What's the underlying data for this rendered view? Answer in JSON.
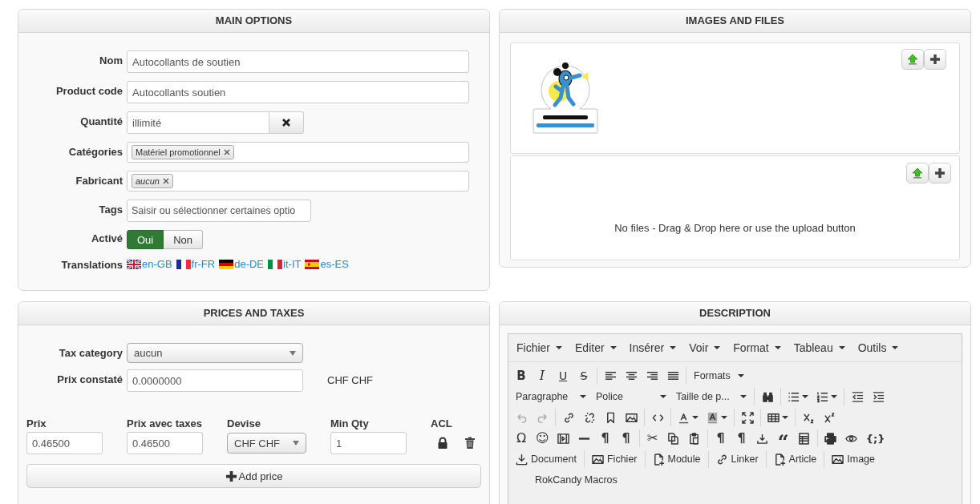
{
  "main_options": {
    "title": "MAIN OPTIONS",
    "fields": [
      {
        "kind": "text",
        "label": "Nom",
        "value": "Autocollants de soutien"
      },
      {
        "kind": "text",
        "label": "Product code",
        "value": "Autocollants soutien"
      },
      {
        "kind": "clearable",
        "label": "Quantité",
        "value": "illimité"
      },
      {
        "kind": "tags",
        "label": "Catégories",
        "tags": [
          {
            "text": "Matériel promotionnel",
            "italic": false
          }
        ]
      },
      {
        "kind": "tags",
        "label": "Fabricant",
        "tags": [
          {
            "text": "aucun",
            "italic": true
          }
        ]
      },
      {
        "kind": "short",
        "label": "Tags",
        "placeholder": "Saisir ou sélectionner certaines optio"
      },
      {
        "kind": "toggle",
        "label": "Activé",
        "options": [
          {
            "label": "Oui",
            "selected": true
          },
          {
            "label": "Non",
            "selected": false
          }
        ]
      },
      {
        "kind": "translations",
        "label": "Translations",
        "links": [
          {
            "kind": "gb",
            "text": "en-GB"
          },
          {
            "kind": "fr",
            "text": "fr-FR"
          },
          {
            "kind": "de",
            "text": "de-DE"
          },
          {
            "kind": "it",
            "text": "it-IT"
          },
          {
            "kind": "es",
            "text": "es-ES"
          }
        ]
      }
    ]
  },
  "images_and_files": {
    "title": "IMAGES AND FILES",
    "files_message": "No files - Drag & Drop here or use the upload button"
  },
  "prices_and_taxes": {
    "title": "PRICES AND TAXES",
    "tax_category": {
      "label": "Tax category",
      "value": "aucun"
    },
    "list_price": {
      "label": "Prix constaté",
      "value": "0.0000000",
      "currency": "CHF CHF"
    },
    "columns": [
      "Prix",
      "Prix avec taxes",
      "Devise",
      "Min Qty",
      "ACL"
    ],
    "rows": [
      {
        "price": "0.46500",
        "price_with_tax": "0.46500",
        "currency": "CHF CHF",
        "min_qty": "1"
      }
    ],
    "add_button": "Add price"
  },
  "description": {
    "title": "DESCRIPTION",
    "menubar": [
      "Fichier",
      "Editer",
      "Insérer",
      "Voir",
      "Format",
      "Tableau",
      "Outils"
    ],
    "toolbar_rows": [
      [
        {
          "kind": "bold",
          "text": "B",
          "disabled": false,
          "dropdown": false
        },
        {
          "kind": "italic",
          "text": "I",
          "disabled": false,
          "dropdown": false
        },
        {
          "kind": "underline",
          "text": "U",
          "disabled": false,
          "dropdown": false
        },
        {
          "kind": "strike",
          "text": "S",
          "disabled": false,
          "dropdown": false
        },
        {
          "kind": "sep"
        },
        {
          "kind": "alignleft",
          "disabled": false,
          "dropdown": false
        },
        {
          "kind": "aligncenter",
          "disabled": false,
          "dropdown": false
        },
        {
          "kind": "alignright",
          "disabled": false,
          "dropdown": false
        },
        {
          "kind": "justify",
          "disabled": false,
          "dropdown": false
        },
        {
          "kind": "sep"
        },
        {
          "kind": "select",
          "text": "Formats"
        }
      ],
      [
        {
          "kind": "select",
          "text": "Paragraphe"
        },
        {
          "kind": "select",
          "text": "Police"
        },
        {
          "kind": "select",
          "text": "Taille de p..."
        },
        {
          "kind": "sep"
        },
        {
          "kind": "search",
          "disabled": false,
          "dropdown": false
        },
        {
          "kind": "sep"
        },
        {
          "kind": "bullist",
          "disabled": false,
          "dropdown": true
        },
        {
          "kind": "numlist",
          "disabled": false,
          "dropdown": true
        },
        {
          "kind": "sep"
        },
        {
          "kind": "outdent",
          "disabled": false,
          "dropdown": false
        },
        {
          "kind": "indent",
          "disabled": false,
          "dropdown": false
        }
      ],
      [
        {
          "kind": "undo",
          "disabled": true,
          "dropdown": false
        },
        {
          "kind": "redo",
          "disabled": true,
          "dropdown": false
        },
        {
          "kind": "sep"
        },
        {
          "kind": "link",
          "disabled": false,
          "dropdown": false
        },
        {
          "kind": "unlink",
          "disabled": false,
          "dropdown": false
        },
        {
          "kind": "bookmark",
          "disabled": false,
          "dropdown": false
        },
        {
          "kind": "image",
          "disabled": false,
          "dropdown": false
        },
        {
          "kind": "sep"
        },
        {
          "kind": "code",
          "disabled": false,
          "dropdown": false
        },
        {
          "kind": "sep"
        },
        {
          "kind": "forecolor",
          "disabled": false,
          "dropdown": true
        },
        {
          "kind": "backcolor",
          "disabled": false,
          "dropdown": true
        },
        {
          "kind": "sep"
        },
        {
          "kind": "fullscreen",
          "disabled": false,
          "dropdown": false
        },
        {
          "kind": "sep"
        },
        {
          "kind": "table",
          "disabled": false,
          "dropdown": true
        },
        {
          "kind": "sep"
        },
        {
          "kind": "subscript",
          "disabled": false,
          "dropdown": false
        },
        {
          "kind": "superscript",
          "disabled": false,
          "dropdown": false
        }
      ],
      [
        {
          "kind": "omega",
          "text": "Ω",
          "disabled": false,
          "dropdown": false
        },
        {
          "kind": "emoticon",
          "text": "☺",
          "disabled": false,
          "dropdown": false
        },
        {
          "kind": "media",
          "disabled": false,
          "dropdown": false
        },
        {
          "kind": "hr",
          "disabled": false,
          "dropdown": false
        },
        {
          "kind": "ltr",
          "text": "¶",
          "disabled": false,
          "dropdown": false
        },
        {
          "kind": "rtl",
          "text": "¶",
          "disabled": false,
          "dropdown": false
        },
        {
          "kind": "sep"
        },
        {
          "kind": "cut",
          "text": "✂",
          "disabled": false,
          "dropdown": false
        },
        {
          "kind": "copy",
          "disabled": false,
          "dropdown": false
        },
        {
          "kind": "paste",
          "disabled": false,
          "dropdown": false
        },
        {
          "kind": "sep"
        },
        {
          "kind": "pilcrow",
          "text": "¶",
          "disabled": false,
          "dropdown": false
        },
        {
          "kind": "paragraph",
          "text": "¶",
          "disabled": false,
          "dropdown": false
        },
        {
          "kind": "insert",
          "disabled": false,
          "dropdown": false
        },
        {
          "kind": "quote",
          "text": "“",
          "disabled": false,
          "dropdown": false
        },
        {
          "kind": "template",
          "disabled": false,
          "dropdown": false
        },
        {
          "kind": "sep"
        },
        {
          "kind": "print",
          "disabled": false,
          "dropdown": false
        },
        {
          "kind": "preview",
          "disabled": false,
          "dropdown": false
        },
        {
          "kind": "codesample",
          "text": "{;}",
          "disabled": false,
          "dropdown": false
        }
      ],
      [
        {
          "kind": "download",
          "label": "Document"
        },
        {
          "kind": "sep"
        },
        {
          "kind": "image",
          "label": "Fichier"
        },
        {
          "kind": "sep"
        },
        {
          "kind": "docplus",
          "label": "Module"
        },
        {
          "kind": "sep"
        },
        {
          "kind": "link",
          "label": "Linker"
        },
        {
          "kind": "sep"
        },
        {
          "kind": "docplus",
          "label": "Article"
        },
        {
          "kind": "sep"
        },
        {
          "kind": "image",
          "label": "Image"
        }
      ],
      [
        {
          "kind": "macros",
          "label": "RokCandy Macros"
        }
      ]
    ]
  }
}
